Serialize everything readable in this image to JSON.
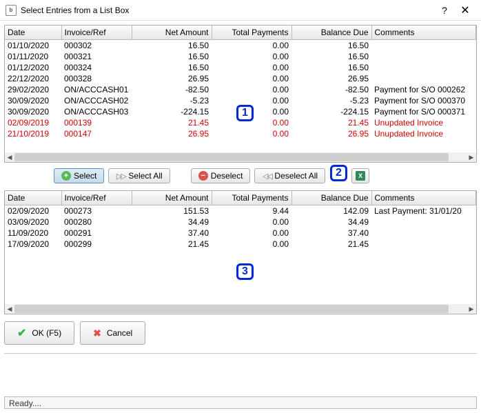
{
  "window": {
    "title": "Select Entries from a List Box"
  },
  "columns": [
    "Date",
    "Invoice/Ref",
    "Net Amount",
    "Total Payments",
    "Balance Due",
    "Comments"
  ],
  "topRows": [
    {
      "date": "01/10/2020",
      "ref": "000302",
      "net": "16.50",
      "pay": "0.00",
      "bal": "16.50",
      "com": "",
      "red": false
    },
    {
      "date": "01/11/2020",
      "ref": "000321",
      "net": "16.50",
      "pay": "0.00",
      "bal": "16.50",
      "com": "",
      "red": false
    },
    {
      "date": "01/12/2020",
      "ref": "000324",
      "net": "16.50",
      "pay": "0.00",
      "bal": "16.50",
      "com": "",
      "red": false
    },
    {
      "date": "22/12/2020",
      "ref": "000328",
      "net": "26.95",
      "pay": "0.00",
      "bal": "26.95",
      "com": "",
      "red": false
    },
    {
      "date": "29/02/2020",
      "ref": "ON/ACCCASH01",
      "net": "-82.50",
      "pay": "0.00",
      "bal": "-82.50",
      "com": "Payment for S/O 000262",
      "red": false
    },
    {
      "date": "30/09/2020",
      "ref": "ON/ACCCASH02",
      "net": "-5.23",
      "pay": "0.00",
      "bal": "-5.23",
      "com": "Payment for S/O 000370",
      "red": false
    },
    {
      "date": "30/09/2020",
      "ref": "ON/ACCCASH03",
      "net": "-224.15",
      "pay": "0.00",
      "bal": "-224.15",
      "com": "Payment for S/O 000371",
      "red": false
    },
    {
      "date": "02/09/2019",
      "ref": "000139",
      "net": "21.45",
      "pay": "0.00",
      "bal": "21.45",
      "com": "Unupdated Invoice",
      "red": true
    },
    {
      "date": "21/10/2019",
      "ref": "000147",
      "net": "26.95",
      "pay": "0.00",
      "bal": "26.95",
      "com": "Unupdated Invoice",
      "red": true
    }
  ],
  "bottomRows": [
    {
      "date": "02/09/2020",
      "ref": "000273",
      "net": "151.53",
      "pay": "9.44",
      "bal": "142.09",
      "com": "Last Payment: 31/01/20"
    },
    {
      "date": "03/09/2020",
      "ref": "000280",
      "net": "34.49",
      "pay": "0.00",
      "bal": "34.49",
      "com": ""
    },
    {
      "date": "11/09/2020",
      "ref": "000291",
      "net": "37.40",
      "pay": "0.00",
      "bal": "37.40",
      "com": ""
    },
    {
      "date": "17/09/2020",
      "ref": "000299",
      "net": "21.45",
      "pay": "0.00",
      "bal": "21.45",
      "com": ""
    }
  ],
  "buttons": {
    "select": "Select",
    "selectAll": "Select All",
    "deselect": "Deselect",
    "deselectAll": "Deselect All"
  },
  "footer": {
    "ok": "OK (F5)",
    "cancel": "Cancel"
  },
  "status": "Ready....",
  "callouts": {
    "1": "1",
    "2": "2",
    "3": "3"
  }
}
